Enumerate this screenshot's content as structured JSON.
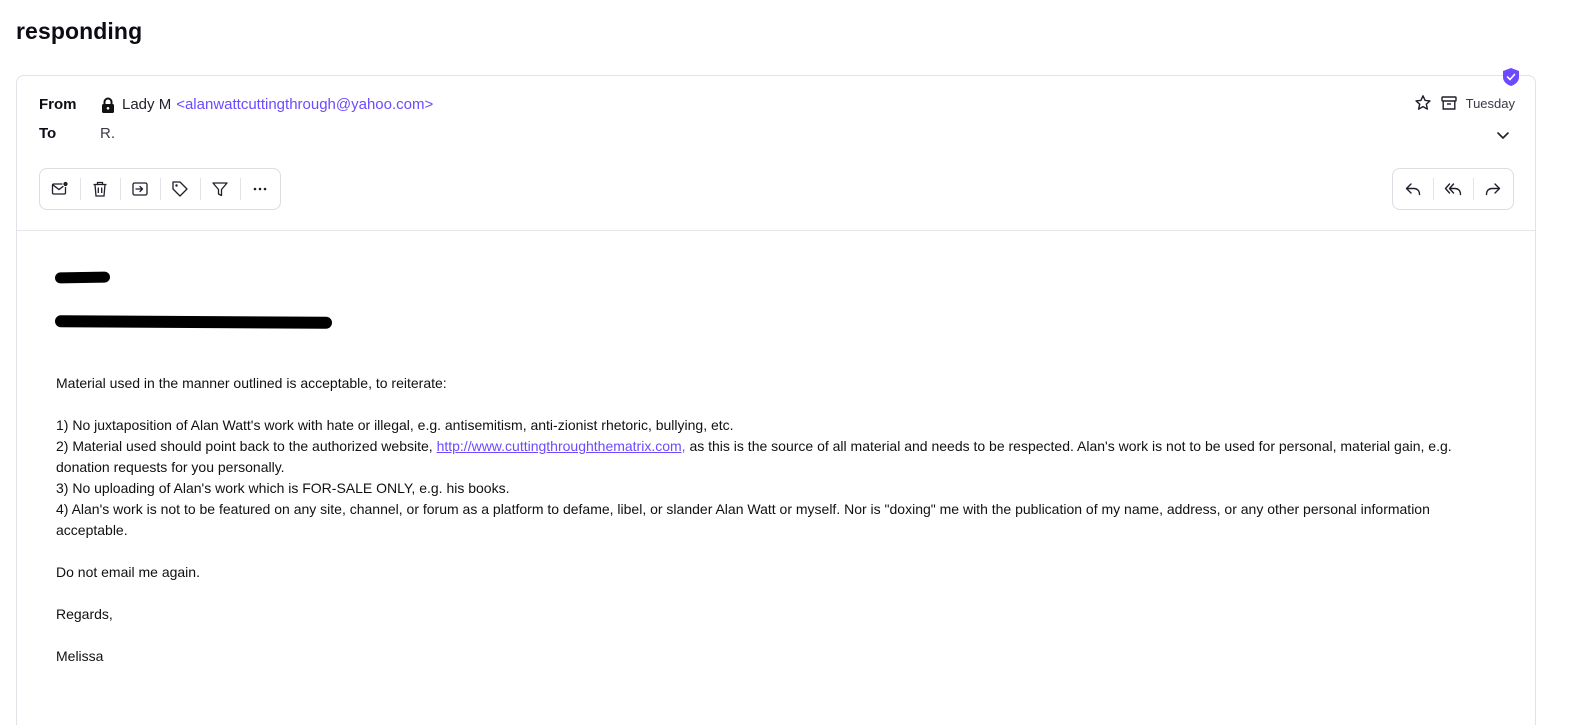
{
  "subject": "responding",
  "header": {
    "from_label": "From",
    "to_label": "To",
    "sender_name": "Lady M",
    "sender_email": "<alanwattcuttingthrough@yahoo.com>",
    "recipient": "R.",
    "date": "Tuesday"
  },
  "toolbar": {
    "left_icons": [
      "mark-unread-icon",
      "trash-icon",
      "move-icon",
      "label-icon",
      "filter-icon",
      "more-icon"
    ],
    "right_icons": [
      "reply-icon",
      "reply-all-icon",
      "forward-icon"
    ]
  },
  "body": {
    "intro": "Material used in the manner outlined is acceptable, to reiterate:",
    "rule1": "1) No juxtaposition of Alan Watt's work with hate or illegal, e.g. antisemitism, anti-zionist rhetoric, bullying, etc.",
    "rule2_pre": "2) Material used should point back to the authorized website, ",
    "rule2_link": "http://www.cuttingthroughthematrix.com,",
    "rule2_post": " as this is the source of all material and needs to be respected.  Alan's work is not to be used for personal, material gain, e.g. donation requests for you personally.",
    "rule3": "3) No uploading of Alan's work which is FOR-SALE ONLY, e.g. his books.",
    "rule4": "4) Alan's work is not to be featured on any site, channel, or forum as a platform to defame, libel, or slander Alan Watt or myself.  Nor is \"doxing\" me with the publication of my name, address, or any other personal information acceptable.",
    "closing": "Do not email me again.",
    "regards": "Regards,",
    "signature": "Melissa"
  },
  "colors": {
    "accent": "#6d4aff",
    "border": "#e2e2e8",
    "text": "#0c0c14"
  }
}
